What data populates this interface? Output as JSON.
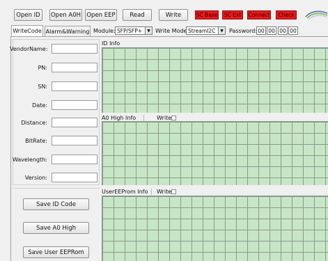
{
  "toolbar": {
    "open_id": "Open ID",
    "open_a0h": "Open A0H",
    "open_eep": "Open EEP",
    "read": "Read",
    "write": "Write",
    "sc_base": "SC Base",
    "sc_ext": "SC Ext",
    "connect": "Connect",
    "check": "Check",
    "accent_red": "#e8191a"
  },
  "tabs": {
    "write_code": "WriteCode",
    "alarm_warning": "Alarm&Warning"
  },
  "options": {
    "module_label": "Module:",
    "module_value": "SFP/SFP+",
    "write_mode_label": "Write Mode:",
    "write_mode_value": "StreamI2C",
    "password_label": "Password:",
    "password": [
      "00",
      "00",
      "00",
      "00"
    ]
  },
  "fields": {
    "vendor_name": "VendorName:",
    "pn": "PN:",
    "sn": "SN:",
    "date": "Date:",
    "distance": "Distance:",
    "bitrate": "BitRate:",
    "wavelength": "Wavelength:",
    "version": "Version:"
  },
  "actions": {
    "save_id": "Save ID Code",
    "save_a0": "Save A0 High",
    "save_eeprom": "Save User EEPRom"
  },
  "grids": {
    "id_info": "ID Info",
    "a0_high_info": "A0 High Info",
    "a0_write": "Write",
    "user_eeprom_info": "UserEEProm Info",
    "eeprom_write": "Write",
    "cell_color": "#c7e6c7"
  }
}
